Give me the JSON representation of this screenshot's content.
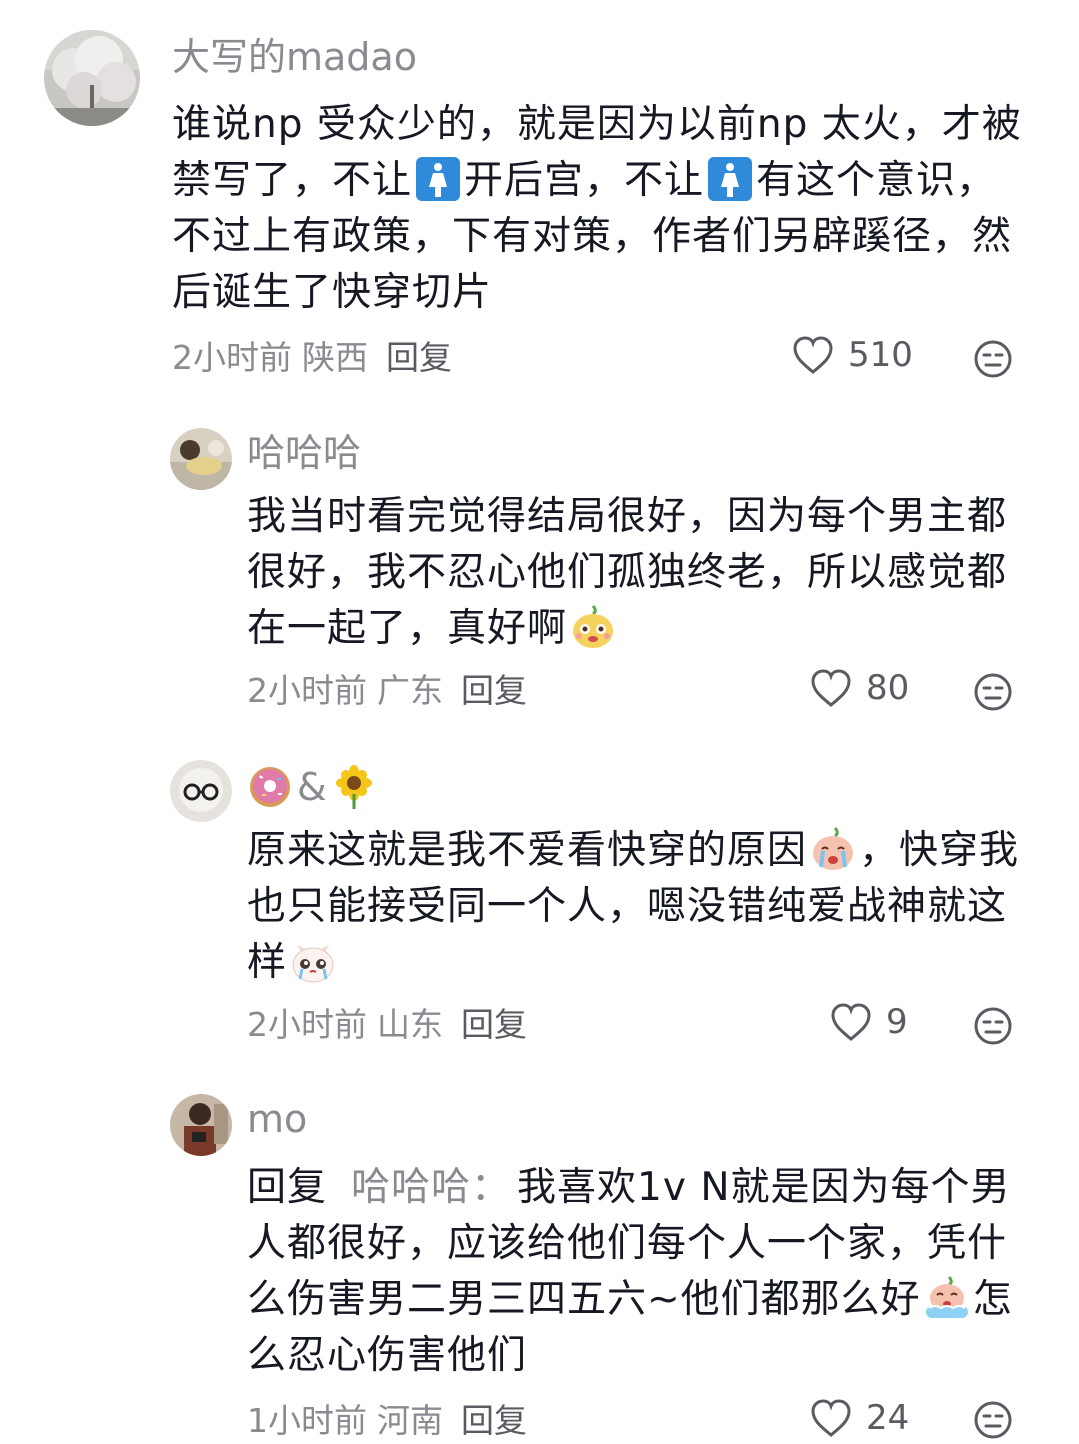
{
  "comments": [
    {
      "username": "大写的madao",
      "text_parts": [
        "谁说np 受众少的，就是因为以前np 太火，才被禁写了，不让",
        "开后宫，不让",
        "有这个意识，不过上有政策，下有对策，作者们另辟蹊径，然后诞生了快穿切片"
      ],
      "emoji_icons": [
        "womens-restroom-icon",
        "womens-restroom-icon"
      ],
      "time": "2小时前",
      "location": "陕西",
      "reply_label": "回复",
      "likes": "510"
    },
    {
      "username": "哈哈哈",
      "text_parts": [
        "我当时看完觉得结局很好，因为每个男主都很好，我不忍心他们孤独终老，所以感觉都在一起了，真好啊"
      ],
      "emoji_icons": [
        "cute-face-emoji-icon"
      ],
      "time": "2小时前",
      "location": "广东",
      "reply_label": "回复",
      "likes": "80"
    },
    {
      "username_parts": [
        "&"
      ],
      "username_icons": [
        "donut-icon",
        "sunflower-icon"
      ],
      "text_parts": [
        "原来这就是我不爱看快穿的原因",
        "，快穿我也只能接受同一个人，嗯没错纯爱战神就这样"
      ],
      "emoji_icons": [
        "crying-face-emoji-icon",
        "crying-cat-emoji-icon"
      ],
      "time": "2小时前",
      "location": "山东",
      "reply_label": "回复",
      "likes": "9"
    },
    {
      "username": "mo",
      "reply_prefix": "回复",
      "reply_target": "哈哈哈：",
      "text_parts": [
        "我喜欢1v N就是因为每个男人都很好，应该给他们每个人一个家，凭什么伤害男二男三四五六~他们都那么好",
        "怎么忍心伤害他们"
      ],
      "emoji_icons": [
        "crying-bath-emoji-icon"
      ],
      "time": "1小时前",
      "location": "河南",
      "reply_label": "回复",
      "likes": "24"
    }
  ],
  "colors": {
    "primary_text": "#161823",
    "secondary_text": "#8a8b91",
    "icon_gray": "#5a5b62"
  }
}
